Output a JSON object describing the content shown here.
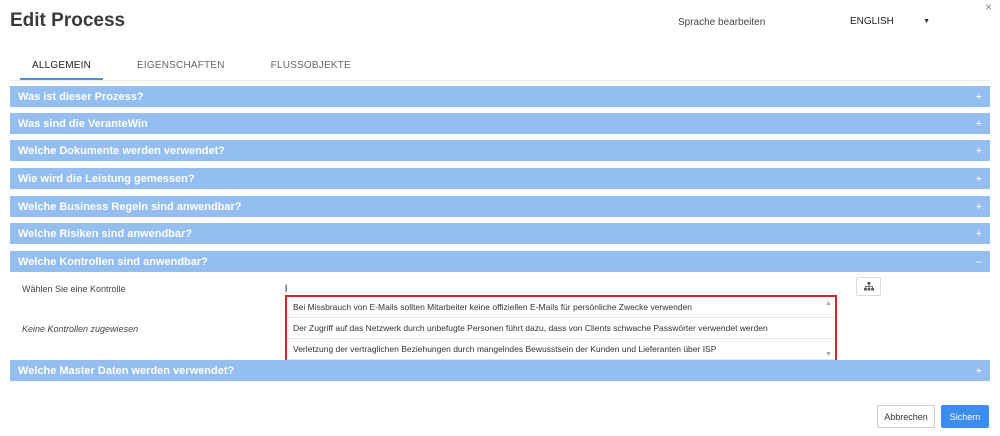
{
  "header": {
    "title": "Edit Process",
    "close_symbol": "×",
    "language_label": "Sprache bearbeiten",
    "language_value": "ENGLISH"
  },
  "tabs": [
    {
      "label": "ALLGEMEIN",
      "active": true
    },
    {
      "label": "EIGENSCHAFTEN",
      "active": false
    },
    {
      "label": "FLUSSOBJEKTE",
      "active": false
    }
  ],
  "panels": [
    {
      "label": "Was ist dieser Prozess?",
      "toggle": "+"
    },
    {
      "label": "Was sind die VeranteWin",
      "toggle": "+"
    },
    {
      "label": "Welche Dokumente werden verwendet?",
      "toggle": "+"
    },
    {
      "label": "Wie wird die Leistung gemessen?",
      "toggle": "+"
    },
    {
      "label": "Welche Business Regeln sind anwendbar?",
      "toggle": "+"
    },
    {
      "label": "Welche Risiken sind anwendbar?",
      "toggle": "+"
    },
    {
      "label": "Welche Kontrollen sind anwendbar?",
      "toggle": "–"
    },
    {
      "label": "Welche Master Daten werden verwendet?",
      "toggle": "+"
    }
  ],
  "controls_section": {
    "select_label": "Wählen Sie eine Kontrolle",
    "input_value": "l",
    "empty_text": "Keine Kontrollen zugewiesen",
    "dropdown_items": [
      "Bei Missbrauch von E-Mails sollten Mitarbeiter keine offiziellen E-Mails für persönliche Zwecke verwenden",
      "Der Zugriff auf das Netzwerk durch unbefugte Personen führt dazu, dass von Clients schwache Passwörter verwendet werden",
      "Verletzung der vertraglichen Beziehungen durch mangelndes Bewusstsein der Kunden und Lieferanten über ISP"
    ]
  },
  "footer": {
    "cancel_label": "Abbrechen",
    "save_label": "Sichern"
  },
  "colors": {
    "panel_bg": "#94bef0",
    "primary": "#3c8df0",
    "highlight_border": "#d8222a",
    "tab_underline": "#4a8fe0"
  },
  "icons": {
    "close": "close-icon",
    "language_caret": "caret-down-icon",
    "tree": "hierarchy-icon"
  }
}
